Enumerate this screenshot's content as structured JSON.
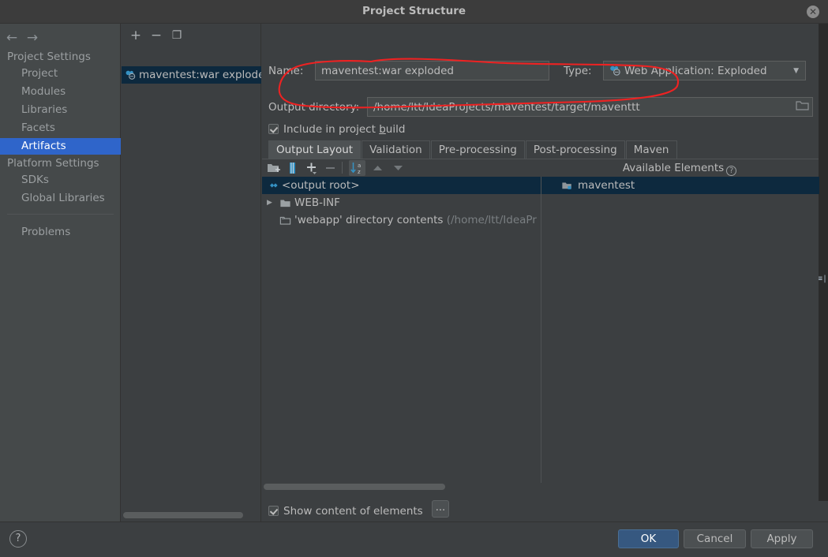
{
  "window": {
    "title": "Project Structure",
    "close_label": "✕"
  },
  "sidebar": {
    "nav": {
      "back": "←",
      "forward": "→"
    },
    "groups": [
      {
        "title": "Project Settings",
        "items": [
          {
            "label": "Project",
            "selected": false
          },
          {
            "label": "Modules",
            "selected": false
          },
          {
            "label": "Libraries",
            "selected": false
          },
          {
            "label": "Facets",
            "selected": false
          },
          {
            "label": "Artifacts",
            "selected": true
          }
        ]
      },
      {
        "title": "Platform Settings",
        "items": [
          {
            "label": "SDKs",
            "selected": false
          },
          {
            "label": "Global Libraries",
            "selected": false
          }
        ]
      }
    ],
    "extra_items": [
      {
        "label": "Problems",
        "selected": false
      }
    ]
  },
  "artifacts_panel": {
    "toolbar": [
      {
        "name": "add-artifact-button",
        "glyph": "+"
      },
      {
        "name": "remove-artifact-button",
        "glyph": "−"
      },
      {
        "name": "copy-artifact-button",
        "glyph": "❐"
      }
    ],
    "items": [
      {
        "label": "maventest:war exploded",
        "selected": true,
        "icon": "war-artifact-icon"
      }
    ]
  },
  "editor": {
    "name_label": "Name:",
    "name_value": "maventest:war exploded",
    "type_label": "Type:",
    "type_value": "Web Application: Exploded",
    "type_icon": "war-artifact-icon",
    "output_dir_label": "Output directory:",
    "output_dir_value": "/home/ltt/IdeaProjects/maventest/target/maventtt",
    "browse_icon": "folder-browse-icon",
    "include_in_build": {
      "label_before": "Include in project ",
      "label_mnemonic": "b",
      "label_after": "uild",
      "checked": true
    },
    "tabs": [
      {
        "label": "Output Layout",
        "active": true
      },
      {
        "label": "Validation",
        "active": false
      },
      {
        "label": "Pre-processing",
        "active": false
      },
      {
        "label": "Post-processing",
        "active": false
      },
      {
        "label": "Maven",
        "active": false
      }
    ],
    "elements_toolbar": [
      {
        "name": "add-directory-button",
        "icon": "folder-plus-icon"
      },
      {
        "name": "add-archive-button",
        "icon": "archive-icon"
      },
      {
        "name": "add-copy-button",
        "icon": "plus-dropdown-icon"
      },
      {
        "name": "remove-element-button",
        "icon": "minus-icon"
      },
      {
        "name": "sort-elements-button",
        "icon": "sort-az-icon",
        "active": true
      },
      {
        "name": "move-up-button",
        "icon": "arrow-up-icon"
      },
      {
        "name": "move-down-button",
        "icon": "arrow-down-icon"
      }
    ],
    "available_elements_header": "Available Elements",
    "available_help_glyph": "?",
    "output_tree": [
      {
        "label": "<output root>",
        "icon": "output-root-icon",
        "selected": true,
        "indent": 0,
        "expander": "",
        "suffix": ""
      },
      {
        "label": "WEB-INF",
        "icon": "folder-icon",
        "selected": false,
        "indent": 1,
        "expander": "▶",
        "suffix": ""
      },
      {
        "label": "'webapp' directory contents",
        "icon": "directory-contents-icon",
        "selected": false,
        "indent": 1,
        "expander": "",
        "suffix": " (/home/ltt/IdeaPr"
      }
    ],
    "available_tree": [
      {
        "label": "maventest",
        "icon": "module-icon",
        "selected": true
      }
    ],
    "show_content": {
      "label": "Show content of elements",
      "checked": true
    },
    "ellipsis_button": "..."
  },
  "footer": {
    "help_glyph": "?",
    "buttons": [
      {
        "label": "OK",
        "primary": true
      },
      {
        "label": "Cancel",
        "primary": false
      },
      {
        "label": "Apply",
        "primary": false
      }
    ]
  },
  "behind": {
    "glyph": "≡|"
  },
  "colors": {
    "accent_selection": "#2f65ca",
    "tree_selection": "#0d293e",
    "primary_button": "#365880",
    "annotation_red": "#ee2222",
    "panel_bg": "#3c3f41",
    "sidebar_bg": "#45494a",
    "text": "#bbbbbb"
  }
}
